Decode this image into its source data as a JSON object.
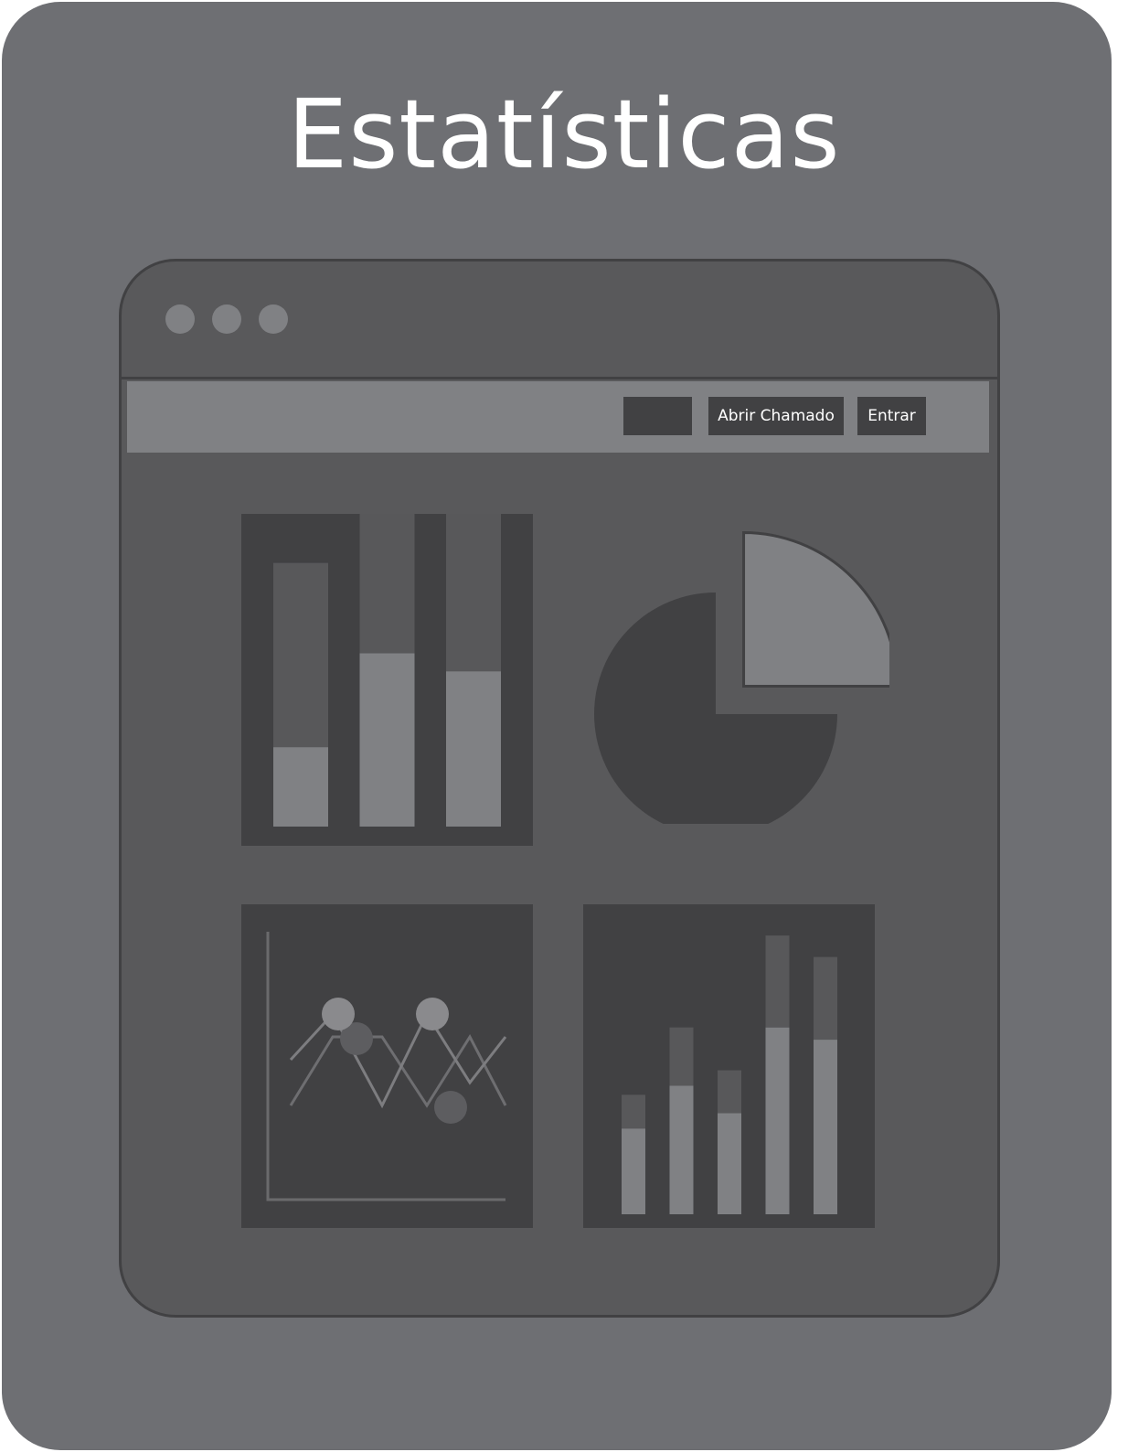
{
  "page": {
    "title": "Estatísticas"
  },
  "colors": {
    "background": "#6e6f73",
    "window": "#59595b",
    "dark": "#414143",
    "light": "#808184",
    "mid": "#58585a",
    "text": "#ffffff"
  },
  "window": {
    "controls": [
      "window-dot",
      "window-dot",
      "window-dot"
    ]
  },
  "navbar": {
    "buttons": [
      {
        "label": ""
      },
      {
        "label": "Abrir Chamado"
      },
      {
        "label": "Entrar"
      }
    ]
  },
  "chart_data": [
    {
      "type": "bar",
      "stacked": true,
      "categories": [
        "",
        "",
        ""
      ],
      "series": [
        {
          "values": [
            0.22,
            0.48,
            0.43
          ]
        },
        {
          "values": [
            0.51,
            0.52,
            0.46
          ]
        }
      ],
      "ylim": [
        0,
        1
      ],
      "grid": false
    },
    {
      "type": "pie",
      "values": [
        0.25,
        0.75
      ],
      "exploded": [
        true,
        false
      ]
    },
    {
      "type": "line",
      "x": [
        1,
        2,
        3,
        4,
        5,
        6
      ],
      "series": [
        {
          "values": [
            3,
            1,
            5,
            1,
            4,
            2
          ]
        },
        {
          "values": [
            5,
            2,
            2,
            5,
            2,
            5
          ]
        }
      ],
      "markers": [
        {
          "series": 1,
          "index": 1
        },
        {
          "series": 0,
          "index": 1
        },
        {
          "series": 1,
          "index": 3
        },
        {
          "series": 0,
          "index": 3
        }
      ],
      "grid": false
    },
    {
      "type": "bar",
      "stacked": true,
      "categories": [
        "",
        "",
        "",
        "",
        ""
      ],
      "series": [
        {
          "values": [
            0.28,
            0.42,
            0.33,
            0.61,
            0.57
          ]
        },
        {
          "values": [
            0.11,
            0.19,
            0.14,
            0.3,
            0.27
          ]
        }
      ],
      "ylim": [
        0,
        1
      ],
      "grid": false
    }
  ]
}
